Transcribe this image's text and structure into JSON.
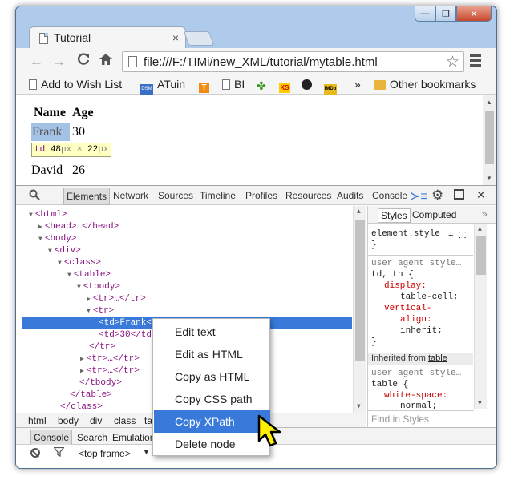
{
  "tab": {
    "title": "Tutorial",
    "close": "×"
  },
  "window": {
    "minimize": "—",
    "maximize": "❐",
    "close": "✕"
  },
  "address": {
    "url": "file:///F:/TIMi/new_XML/tutorial/mytable.html"
  },
  "nav": {
    "back": "←",
    "forward": "→",
    "reload": "C",
    "home": "⌂",
    "star": "☆"
  },
  "bookmarks": {
    "items": [
      {
        "label": "Add to Wish List",
        "icon": "page-icon"
      },
      {
        "label": "ATuin",
        "icon": "dsm-icon",
        "icon_text": "DSM"
      },
      {
        "label": "",
        "icon": "t-icon",
        "icon_text": "T"
      },
      {
        "label": "BI",
        "icon": "page-icon"
      },
      {
        "label": "",
        "icon": "puzzle-icon",
        "icon_text": "✤"
      },
      {
        "label": "",
        "icon": "ks-icon",
        "icon_text": "KS"
      },
      {
        "label": "",
        "icon": "steam-icon",
        "icon_text": ""
      },
      {
        "label": "",
        "icon": "imdb-icon",
        "icon_text": "IMDb"
      }
    ],
    "overflow": "»",
    "other": "Other bookmarks"
  },
  "page": {
    "headers": [
      "Name",
      "Age"
    ],
    "rows": [
      [
        "Frank",
        "30"
      ],
      [
        "David",
        "26"
      ]
    ],
    "tooltip": {
      "tag": "td",
      "size": "48",
      "unit1": "px",
      "times": " × ",
      "h": "22",
      "unit2": "px"
    }
  },
  "devtools": {
    "tabs": [
      "Elements",
      "Network",
      "Sources",
      "Timeline",
      "Profiles",
      "Resources",
      "Audits",
      "Console"
    ],
    "active_tab": "Elements",
    "icons": {
      "search": "🔍",
      "drawer": "≻≡",
      "gear": "⚙",
      "close": "✕"
    },
    "dom": [
      "<html>",
      "<head>…</head>",
      "<body>",
      "<div>",
      "<class>",
      "<table>",
      "<tbody>",
      "<tr>…</tr>",
      "<tr>",
      "<td>Frank</td>",
      "<td>30</td>",
      "</tr>",
      "<tr>…</tr>",
      "<tr>…</tr>",
      "</tbody>",
      "</table>",
      "</class>"
    ],
    "breadcrumbs": [
      "html",
      "body",
      "div",
      "class",
      "ta"
    ],
    "styles": {
      "tabs": [
        "Styles",
        "Computed"
      ],
      "more": "»",
      "element_style": "element.style",
      "element_style_icons": "+ ⸬",
      "close_brace": "}",
      "ua_label": "user agent style…",
      "selector1": "td, th {",
      "p1": "display:",
      "v1": "table-cell;",
      "p2": "vertical-",
      "p2b": "align:",
      "v2": "inherit;",
      "inherited_label": "Inherited from",
      "inherited_link": "table",
      "ua_label2": "user agent style…",
      "selector2": "table {",
      "p3": "white-space:",
      "v3": "normal;",
      "find_placeholder": "Find in Styles"
    },
    "drawer_tabs": [
      "Console",
      "Search",
      "Emulation"
    ],
    "frame": "<top frame>"
  },
  "context_menu": {
    "items": [
      "Edit text",
      "Edit as HTML",
      "Copy as HTML",
      "Copy CSS path",
      "Copy XPath",
      "Delete node"
    ],
    "highlighted": "Copy XPath"
  }
}
